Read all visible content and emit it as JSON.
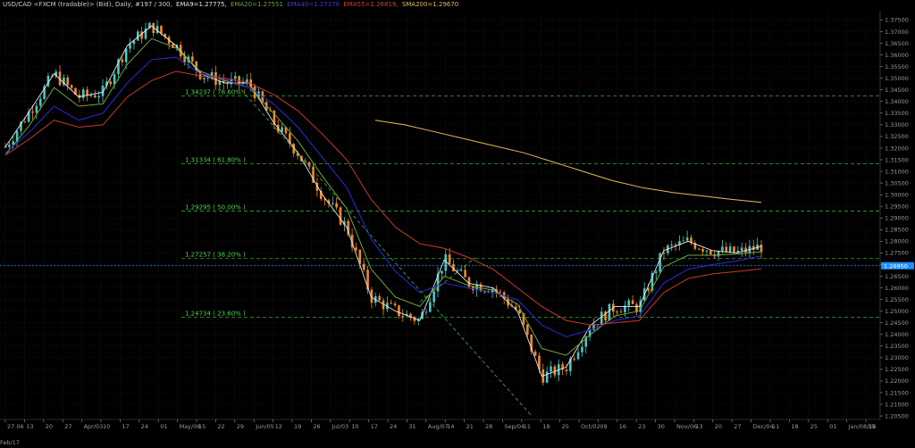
{
  "header": {
    "instrument": "USD/CAD <FXCM (tradable)> (Bid), Daily, #197 / 300,",
    "indicators": [
      {
        "text": "EMA9=1.27775,",
        "color": "#e6e6e6"
      },
      {
        "text": "EMA20=1.27551",
        "color": "#6fa53a"
      },
      {
        "text": "EMA40=1.27370",
        "color": "#2b2bd6"
      },
      {
        "text": "EMA55=1.26819,",
        "color": "#c53a2a"
      },
      {
        "text": "SMA200=1.29670",
        "color": "#e9b95a"
      }
    ]
  },
  "colors": {
    "background": "#000000",
    "bull": "#4fc4c4",
    "bear": "#f08a2a",
    "grid": "#262626",
    "fib_line": "#3aa63a",
    "fib_text": "#4dd24d",
    "ema9": "#e6e6e6",
    "ema20": "#6fa53a",
    "ema40": "#2b2bd6",
    "ema55": "#c53a2a",
    "sma200": "#e9b95a",
    "price_marker": "#1e90ff",
    "axis_text": "#9a9a9a"
  },
  "chart_data": {
    "type": "candlestick",
    "ylim": [
      1.2035,
      1.379
    ],
    "y_ticks": [
      "1.37500",
      "1.37000",
      "1.36500",
      "1.36000",
      "1.35500",
      "1.35000",
      "1.34500",
      "1.34000",
      "1.33500",
      "1.33000",
      "1.32500",
      "1.32000",
      "1.31500",
      "1.31000",
      "1.30500",
      "1.30000",
      "1.29500",
      "1.29000",
      "1.28500",
      "1.28000",
      "1.27500",
      "1.27000",
      "1.26500",
      "1.26000",
      "1.25500",
      "1.25000",
      "1.24500",
      "1.24000",
      "1.23500",
      "1.23000",
      "1.22500",
      "1.22000",
      "1.21500",
      "1.21000",
      "1.20500"
    ],
    "x_ticks": [
      "27 06",
      "13",
      "20",
      "27",
      "Apr/03",
      "10",
      "17",
      "24",
      "01",
      "May/08",
      "15",
      "22",
      "29",
      "Jun/05",
      "12",
      "19",
      "26",
      "Jul/03",
      "10",
      "17",
      "24",
      "31",
      "Aug/07",
      "14",
      "21",
      "28",
      "Sep/04",
      "11",
      "18",
      "25",
      "Oct/02",
      "09",
      "16",
      "23",
      "30",
      "Nov/06",
      "13",
      "20",
      "27",
      "Dec/04",
      "11",
      "18",
      "25",
      "01",
      "Jan/08/18",
      "15"
    ],
    "x_first_label": "Feb/17",
    "last_price": "1.26950",
    "last_price_value": 1.2695,
    "fib_levels": [
      {
        "label": "1.34237 ( 78.60% )",
        "value": 1.34237
      },
      {
        "label": "1.31334 ( 61.80% )",
        "value": 1.31334
      },
      {
        "label": "1.29295 ( 50.00% )",
        "value": 1.29295
      },
      {
        "label": "1.27257 ( 38.20% )",
        "value": 1.27257
      },
      {
        "label": "1.24734 ( 23.60% )",
        "value": 1.24734
      }
    ],
    "trendline": {
      "from_date": "Jun/01",
      "from_value": 1.345,
      "to_date": "Sep/08",
      "to_value": 1.205
    },
    "series": [
      {
        "name": "EMA9",
        "color": "#e6e6e6",
        "values": [
          1.3205,
          1.336,
          1.352,
          1.342,
          1.344,
          1.364,
          1.3725,
          1.364,
          1.352,
          1.348,
          1.348,
          1.331,
          1.318,
          1.3,
          1.286,
          1.256,
          1.25,
          1.246,
          1.272,
          1.262,
          1.26,
          1.25,
          1.222,
          1.226,
          1.244,
          1.252,
          1.252,
          1.276,
          1.28,
          1.276,
          1.275,
          1.2778
        ]
      },
      {
        "name": "EMA20",
        "color": "#6fa53a",
        "values": [
          1.317,
          1.33,
          1.346,
          1.338,
          1.339,
          1.356,
          1.367,
          1.363,
          1.353,
          1.349,
          1.346,
          1.335,
          1.323,
          1.308,
          1.294,
          1.268,
          1.256,
          1.252,
          1.265,
          1.261,
          1.259,
          1.253,
          1.234,
          1.231,
          1.24,
          1.248,
          1.25,
          1.269,
          1.274,
          1.274,
          1.2745,
          1.2755
        ]
      },
      {
        "name": "EMA40",
        "color": "#2b2bd6",
        "values": [
          1.318,
          1.327,
          1.338,
          1.332,
          1.335,
          1.348,
          1.358,
          1.359,
          1.352,
          1.3495,
          1.346,
          1.339,
          1.329,
          1.316,
          1.303,
          1.281,
          1.267,
          1.258,
          1.262,
          1.26,
          1.258,
          1.255,
          1.244,
          1.239,
          1.242,
          1.246,
          1.248,
          1.262,
          1.268,
          1.27,
          1.2715,
          1.2737
        ]
      },
      {
        "name": "EMA55",
        "color": "#c53a2a",
        "values": [
          1.317,
          1.324,
          1.332,
          1.329,
          1.33,
          1.342,
          1.349,
          1.353,
          1.351,
          1.35,
          1.348,
          1.343,
          1.336,
          1.326,
          1.315,
          1.298,
          1.286,
          1.279,
          1.277,
          1.273,
          1.268,
          1.26,
          1.252,
          1.246,
          1.244,
          1.245,
          1.246,
          1.258,
          1.264,
          1.266,
          1.267,
          1.2682
        ]
      },
      {
        "name": "SMA200",
        "color": "#e9b95a",
        "values": [
          1.332,
          1.33,
          1.327,
          1.324,
          1.321,
          1.318,
          1.314,
          1.31,
          1.306,
          1.303,
          1.301,
          1.2995,
          1.298,
          1.2967
        ]
      }
    ]
  }
}
